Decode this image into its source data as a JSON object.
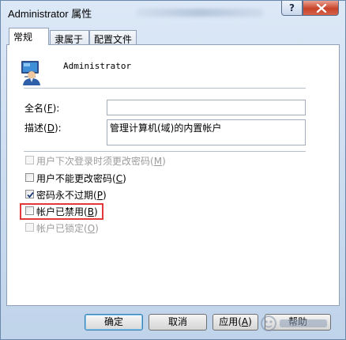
{
  "window": {
    "title": "Administrator 属性",
    "help_glyph": "?",
    "close_label": "X"
  },
  "tabs": [
    {
      "label": "常规",
      "active": true
    },
    {
      "label": "隶属于",
      "active": false
    },
    {
      "label": "配置文件",
      "active": false
    }
  ],
  "user": {
    "name": "Administrator"
  },
  "fields": {
    "fullname_label": "全名",
    "fullname_key": "F",
    "fullname_suffix": "):",
    "fullname_value": "",
    "description_label": "描述",
    "description_key": "D",
    "description_suffix": "):",
    "description_value": "管理计算机(域)的内置帐户"
  },
  "checkboxes": [
    {
      "text": "用户下次登录时须更改密码",
      "key": "M",
      "checked": false,
      "disabled": true
    },
    {
      "text": "用户不能更改密码",
      "key": "C",
      "checked": false,
      "disabled": false
    },
    {
      "text": "密码永不过期",
      "key": "P",
      "checked": true,
      "disabled": false
    },
    {
      "text": "帐户已禁用",
      "key": "B",
      "checked": false,
      "disabled": false
    },
    {
      "text": "帐户已锁定",
      "key": "O",
      "checked": false,
      "disabled": true
    }
  ],
  "buttons": {
    "ok": "确定",
    "cancel": "取消",
    "apply_text": "应用",
    "apply_key": "A",
    "help": "帮助"
  },
  "colors": {
    "highlight": "#e23a3a",
    "accent": "#3c7fb1"
  }
}
